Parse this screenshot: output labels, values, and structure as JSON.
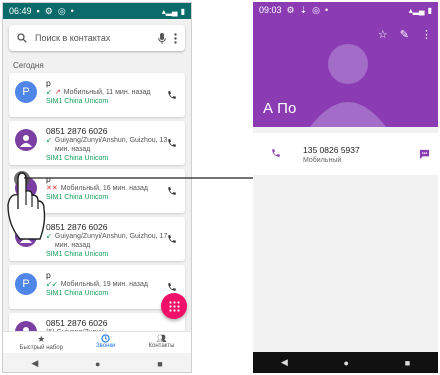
{
  "left": {
    "status_time": "06:49",
    "search_placeholder": "Поиск в контактах",
    "section_today": "Сегодня",
    "calls": [
      {
        "avatar_letter": "P",
        "name": "p",
        "detail": "Мобильный, 11 мин. назад",
        "sim": "SIM1 China Unicom",
        "arrows": [
          "green",
          "red"
        ],
        "avatar_color": "blue"
      },
      {
        "avatar_letter": "",
        "name": "0851 2876 6026",
        "detail": "Guiyang/Zunyi/Anshun, Guizhou, 13 мин. назад",
        "sim": "SIM1 China Unicom",
        "arrows": [
          "green"
        ],
        "avatar_color": "purple"
      },
      {
        "avatar_letter": "",
        "name": "p",
        "detail": "Мобильный, 16 мин. назад",
        "sim": "SIM1 China Unicom",
        "arrows": [
          "red",
          "red"
        ],
        "avatar_color": "purple"
      },
      {
        "avatar_letter": "",
        "name": "0851 2876 6026",
        "detail": "Guiyang/Zunyi/Anshun, Guizhou, 17 мин. назад",
        "sim": "SIM1 China Unicom",
        "arrows": [
          "green"
        ],
        "avatar_color": "purple"
      },
      {
        "avatar_letter": "P",
        "name": "p",
        "detail": "Мобильный, 19 мин. назад",
        "sim": "SIM1 China Unicom",
        "arrows": [
          "green",
          "green"
        ],
        "avatar_color": "blue"
      },
      {
        "avatar_letter": "",
        "name": "0851 2876 6026",
        "detail": "(5) Guiyang/Zunyi/",
        "sim": "",
        "arrows": [],
        "avatar_color": "purple"
      }
    ],
    "nav": {
      "speed_dial": "Быстрый набор",
      "calls": "Звонки",
      "contacts": "Контакты"
    }
  },
  "right": {
    "status_time": "09:03",
    "contact_name": "А По",
    "number": "135 0826 5937",
    "number_type": "Мобильный"
  },
  "colors": {
    "status_bar_left": "#0b6b6b",
    "header_purple": "#8b3cb3",
    "fab_pink": "#f0106a",
    "accent_blue": "#1a73e8",
    "sim_green": "#14a05a"
  }
}
